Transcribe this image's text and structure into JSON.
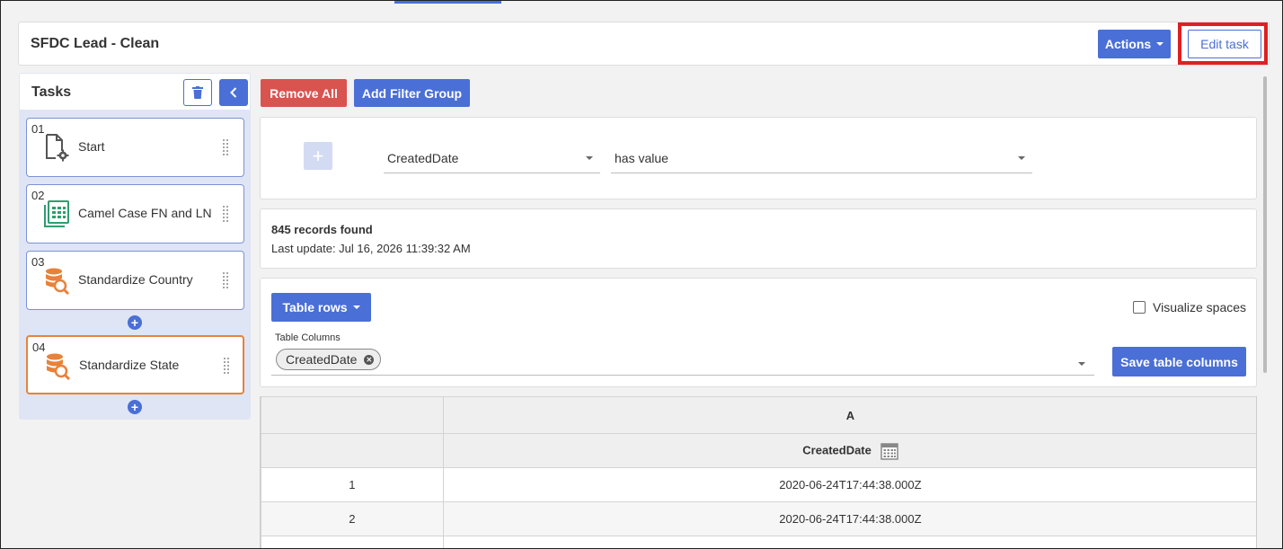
{
  "header": {
    "title": "SFDC Lead - Clean",
    "actions_label": "Actions",
    "edit_task_label": "Edit task"
  },
  "tasks": {
    "heading": "Tasks",
    "items": [
      {
        "num": "01",
        "name": "Start",
        "icon": "file-gear-icon",
        "active": false
      },
      {
        "num": "02",
        "name": "Camel Case FN and LN",
        "icon": "spreadsheet-icon",
        "active": false
      },
      {
        "num": "03",
        "name": "Standardize Country",
        "icon": "database-search-icon",
        "active": false
      },
      {
        "num": "04",
        "name": "Standardize State",
        "icon": "database-search-icon",
        "active": true
      }
    ]
  },
  "toolbar": {
    "remove_all_label": "Remove All",
    "add_filter_group_label": "Add Filter Group"
  },
  "filter": {
    "field_value": "CreatedDate",
    "operator_value": "has value"
  },
  "records": {
    "count_text": "845 records found",
    "last_update_text": "Last update: Jul 16, 2026 11:39:32 AM"
  },
  "table_options": {
    "table_rows_label": "Table rows",
    "visualize_spaces_label": "Visualize spaces",
    "table_columns_label": "Table Columns",
    "selected_columns": [
      "CreatedDate"
    ],
    "save_columns_label": "Save table columns"
  },
  "grid": {
    "column_letter": "A",
    "column_name": "CreatedDate",
    "rows": [
      {
        "index": "1",
        "value": "2020-06-24T17:44:38.000Z"
      },
      {
        "index": "2",
        "value": "2020-06-24T17:44:38.000Z"
      }
    ]
  },
  "colors": {
    "primary": "#4a6fd6",
    "danger": "#d9534f",
    "active_task_border": "#e8823a",
    "highlight": "#e02020"
  }
}
